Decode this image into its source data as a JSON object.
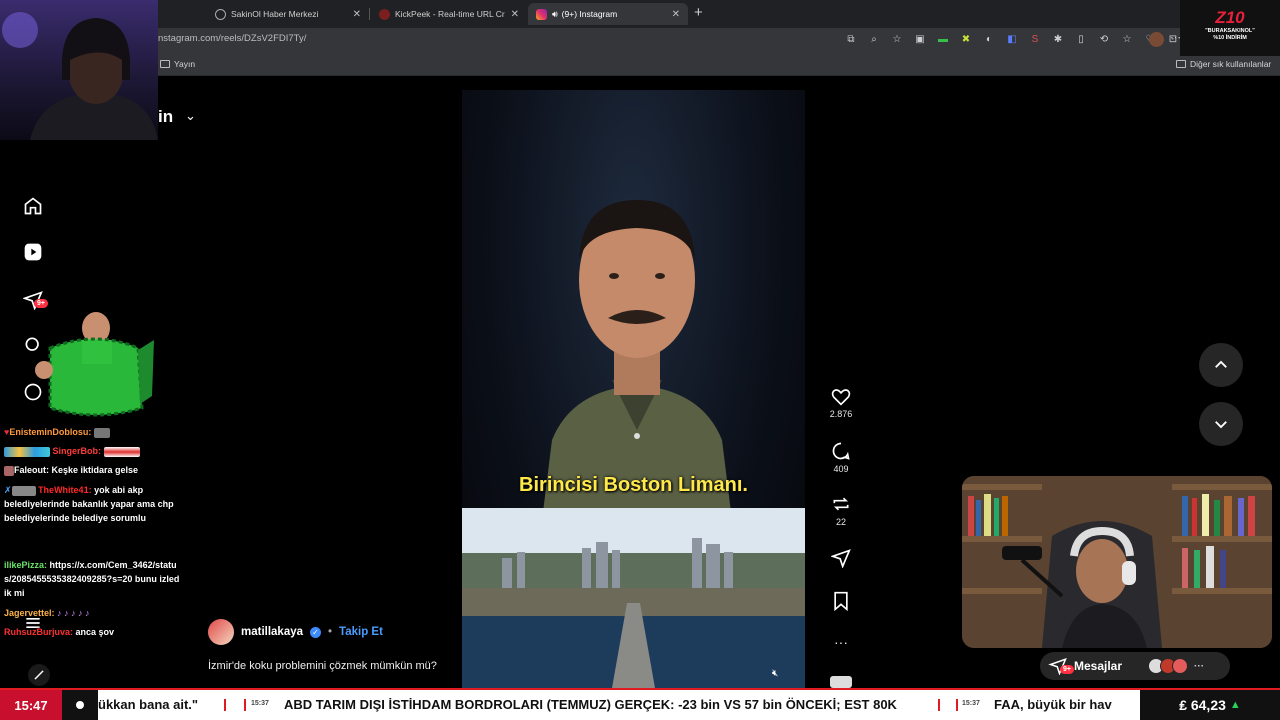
{
  "browser": {
    "tabs": [
      {
        "label": "SakinOl Haber Merkezi",
        "active": false
      },
      {
        "label": "KickPeek - Real-time URL Crawler",
        "active": false
      },
      {
        "label": "(9+) Instagram",
        "active": true
      }
    ],
    "url": "nstagram.com/reels/DZsV2FDI7Ty/",
    "bookmarks": {
      "left_item": "Yayın",
      "right_item": "Diğer sık kullanılanlar"
    }
  },
  "brand_overlay": {
    "logo": "Z10",
    "line1": "\"BURAKSAKINOL\"",
    "line2": "%10 İNDİRİM"
  },
  "instagram": {
    "top_label_fragment": "in",
    "nav": {
      "notifications_badge": "9+"
    },
    "reel": {
      "subtitle": "Birincisi Boston Limanı.",
      "author": "matillakaya",
      "follow_label": "Takip Et",
      "caption": "İzmir'de koku problemini çözmek mümkün mü?"
    },
    "actions": {
      "likes": "2.876",
      "comments": "409",
      "reposts": "22"
    },
    "messages": {
      "label": "Mesajlar",
      "badge": "9+"
    }
  },
  "chat": [
    {
      "user": "EnisteminDoblosu:",
      "text": "",
      "user_color": "#ff9a3c"
    },
    {
      "user": "SingerBob:",
      "text": "",
      "user_color": "#ff3b3b"
    },
    {
      "user": "Faleout:",
      "text": "Keşke iktidara gelse",
      "user_color": "#ffffff"
    },
    {
      "user": "TheWhite41:",
      "text": "yok abi akp belediyelerinde bakanlık yapar ama chp belediyelerinde belediye sorumlu",
      "user_color": "#ff2a2a"
    },
    {
      "user": "ilikePizza:",
      "text": "https://x.com/Cem_3462/status/2085455535382409285?s=20 bunu izledik mi",
      "user_color": "#6de36d"
    },
    {
      "user": "Jagervettel:",
      "text": "",
      "user_color": "#ffb347"
    },
    {
      "user": "RuhsuzBurjuva:",
      "text": "anca şov",
      "user_color": "#ff3030"
    }
  ],
  "ticker": {
    "clock": "15:47",
    "items": [
      {
        "time": "",
        "text": "ükkan bana ait.\""
      },
      {
        "time": "15:37",
        "text": "ABD TARIM DIŞI İSTİHDAM BORDROLARI (TEMMUZ) GERÇEK: -23 bin VS 57 bin ÖNCEKİ; EST 80K"
      },
      {
        "time": "15:37",
        "text": "FAA, büyük bir hav"
      }
    ],
    "price": "₤ 64,23"
  },
  "colors": {
    "accent": "#e01b22",
    "instagram_blue": "#4a9cff",
    "subtitle_yellow": "#ffe94a"
  }
}
